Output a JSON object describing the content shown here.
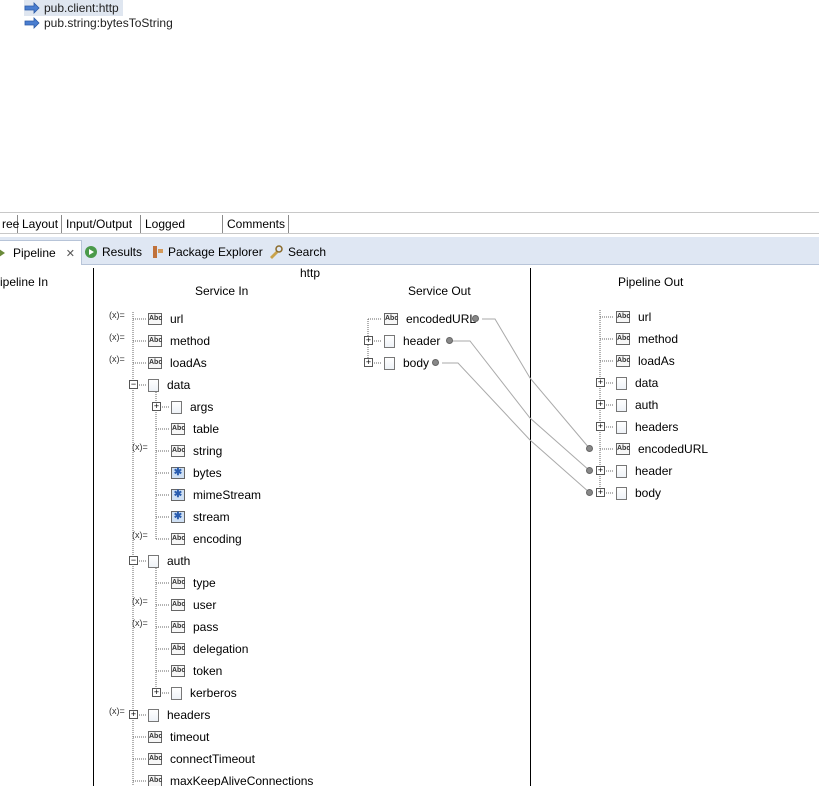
{
  "flow_steps": [
    {
      "label": "pub.client:http",
      "selected": true,
      "icon": "invoke-arrow-icon"
    },
    {
      "label": "pub.string:bytesToString",
      "selected": false,
      "icon": "invoke-arrow-icon"
    }
  ],
  "editor_tabs": [
    "ree",
    "Layout",
    "Input/Output",
    "Logged Fields",
    "Comments"
  ],
  "view_tabs": [
    {
      "label": "Pipeline",
      "icon": "pipeline-icon",
      "active": true,
      "close": "✕"
    },
    {
      "label": "Results",
      "icon": "results-icon"
    },
    {
      "label": "Package Explorer",
      "icon": "package-explorer-icon"
    },
    {
      "label": "Search",
      "icon": "search-icon"
    }
  ],
  "pipeline_in_label": "ipeline In",
  "service_title": "http",
  "service_in_label": "Service In",
  "service_out_label": "Service Out",
  "pipeline_out_label": "Pipeline Out",
  "service_in": [
    {
      "label": "url",
      "type": "abc",
      "mapped": true
    },
    {
      "label": "method",
      "type": "abc",
      "mapped": true
    },
    {
      "label": "loadAs",
      "type": "abc",
      "mapped": true
    },
    {
      "label": "data",
      "type": "doc",
      "expand": "−"
    },
    {
      "label": "args",
      "type": "doc",
      "expand": "+"
    },
    {
      "label": "table",
      "type": "abc-table"
    },
    {
      "label": "string",
      "type": "abc",
      "mapped": true
    },
    {
      "label": "bytes",
      "type": "obj"
    },
    {
      "label": "mimeStream",
      "type": "obj"
    },
    {
      "label": "stream",
      "type": "obj"
    },
    {
      "label": "encoding",
      "type": "abc",
      "mapped": true
    },
    {
      "label": "auth",
      "type": "doc",
      "expand": "−"
    },
    {
      "label": "type",
      "type": "abc"
    },
    {
      "label": "user",
      "type": "abc",
      "mapped": true
    },
    {
      "label": "pass",
      "type": "abc",
      "mapped": true
    },
    {
      "label": "delegation",
      "type": "abc"
    },
    {
      "label": "token",
      "type": "abc"
    },
    {
      "label": "kerberos",
      "type": "doc",
      "expand": "+"
    },
    {
      "label": "headers",
      "type": "doc",
      "expand": "+",
      "mapped": true
    },
    {
      "label": "timeout",
      "type": "abc"
    },
    {
      "label": "connectTimeout",
      "type": "abc"
    },
    {
      "label": "maxKeepAliveConnections",
      "type": "abc"
    }
  ],
  "service_out": [
    {
      "label": "encodedURL",
      "type": "abc"
    },
    {
      "label": "header",
      "type": "doc",
      "expand": "+"
    },
    {
      "label": "body",
      "type": "doc",
      "expand": "+"
    }
  ],
  "pipeline_out": [
    {
      "label": "url",
      "type": "abc"
    },
    {
      "label": "method",
      "type": "abc"
    },
    {
      "label": "loadAs",
      "type": "abc"
    },
    {
      "label": "data",
      "type": "doc",
      "expand": "+"
    },
    {
      "label": "auth",
      "type": "doc",
      "expand": "+"
    },
    {
      "label": "headers",
      "type": "doc",
      "expand": "+"
    },
    {
      "label": "encodedURL",
      "type": "abc"
    },
    {
      "label": "header",
      "type": "doc",
      "expand": "+"
    },
    {
      "label": "body",
      "type": "doc",
      "expand": "+"
    }
  ],
  "icon_glyphs": {
    "abc": "Abc",
    "obj": "✱",
    "map": "(x)="
  }
}
